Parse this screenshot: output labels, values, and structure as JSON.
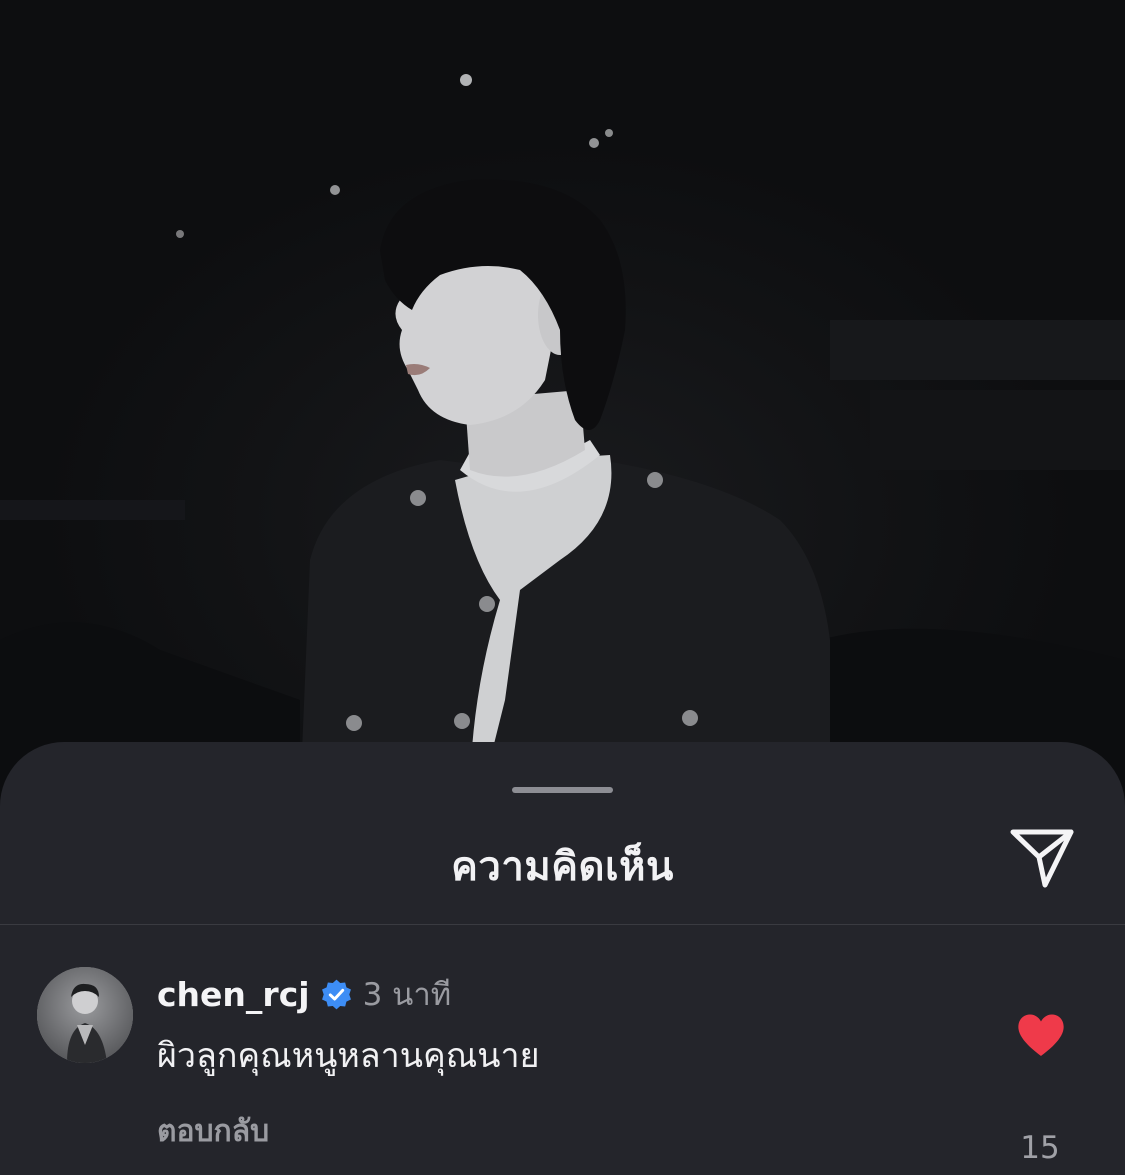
{
  "sheet": {
    "title": "ความคิดเห็น"
  },
  "comment": {
    "username": "chen_rcj",
    "verified": true,
    "time": "3 นาที",
    "text": "ผิวลูกคุณหนูหลานคุณนาย",
    "reply_label": "ตอบกลับ",
    "likes": "15",
    "liked": true
  },
  "colors": {
    "sheet_bg": "#24252b",
    "like_red": "#ef3a4a",
    "verified_blue": "#3d8df5",
    "secondary_text": "#9a9ba1"
  },
  "icons": {
    "share": "paper-plane-icon",
    "verified": "verified-badge-icon",
    "like": "heart-icon"
  }
}
